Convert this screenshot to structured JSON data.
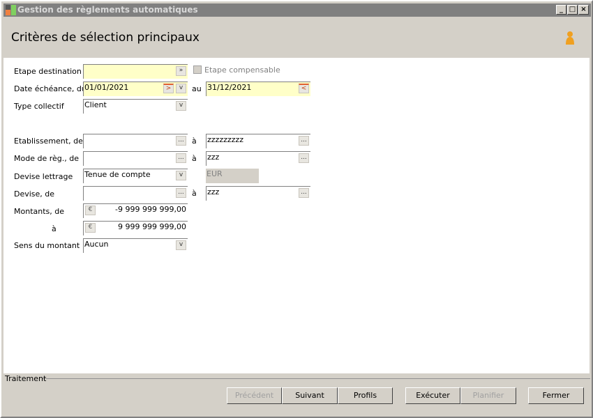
{
  "window": {
    "title": "Gestion des règlements automatiques"
  },
  "header": {
    "title": "Critères de sélection principaux"
  },
  "form": {
    "etape_destination": {
      "label": "Etape destination",
      "value": ""
    },
    "etape_compensable": {
      "label": "Etape compensable",
      "checked": false
    },
    "date_echeance": {
      "label": "Date échéance, du",
      "from": "01/01/2021",
      "to_label": "au",
      "to": "31/12/2021"
    },
    "type_collectif": {
      "label": "Type collectif",
      "value": "Client"
    },
    "etablissement": {
      "label": "Etablissement, de",
      "from": "",
      "to_label": "à",
      "to": "zzzzzzzzz"
    },
    "mode_reg": {
      "label": "Mode de règ., de",
      "from": "",
      "to_label": "à",
      "to": "zzz"
    },
    "devise_lettrage": {
      "label": "Devise lettrage",
      "value": "Tenue de compte",
      "currency": "EUR"
    },
    "devise": {
      "label": "Devise, de",
      "from": "",
      "to_label": "à",
      "to": "zzz"
    },
    "montants": {
      "label": "Montants, de",
      "from": "-9 999 999 999,00",
      "to_label": "à",
      "to": "9 999 999 999,00"
    },
    "sens": {
      "label": "Sens du montant",
      "value": "Aucun"
    }
  },
  "footer": {
    "group_label": "Traitement",
    "buttons": {
      "precedent": "Précédent",
      "suivant": "Suivant",
      "profils": "Profils",
      "executer": "Exécuter",
      "planifier": "Planifier",
      "fermer": "Fermer"
    }
  }
}
